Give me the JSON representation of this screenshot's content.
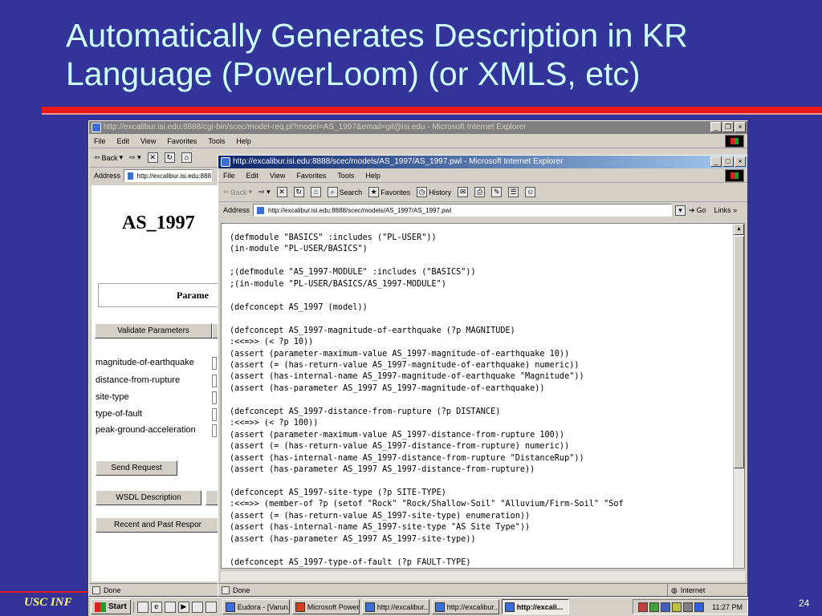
{
  "slide": {
    "title": "Automatically Generates Description in KR Language (PowerLoom) (or XMLS, etc)",
    "footer": "USC INF",
    "page_number": "24"
  },
  "back_window": {
    "title": "http://excalibur.isi.edu:8888/cgi-bin/scec/model-req.pl?model=AS_1997&email=gil@isi.edu - Microsoft Internet Explorer",
    "menu": [
      "File",
      "Edit",
      "View",
      "Favorites",
      "Tools",
      "Help"
    ],
    "toolbar": {
      "back": "Back"
    },
    "address_label": "Address",
    "address": "http://excalibur.isi.edu:888",
    "page_title": "AS_1997",
    "params_header": "Parame",
    "validate_button": "Validate Parameters",
    "params": [
      "magnitude-of-earthquake",
      "distance-from-rupture",
      "site-type",
      "type-of-fault",
      "peak-ground-acceleration"
    ],
    "send_button": "Send Request",
    "wsdl_button": "WSDL Description",
    "recent_button": "Recent and Past Respor",
    "status": "Done"
  },
  "front_window": {
    "title": "http://excalibur.isi.edu:8888/scec/models/AS_1997/AS_1997.pwl - Microsoft Internet Explorer",
    "menu": [
      "File",
      "Edit",
      "View",
      "Favorites",
      "Tools",
      "Help"
    ],
    "toolbar": {
      "back": "Back",
      "search": "Search",
      "favorites": "Favorites",
      "history": "History"
    },
    "address_label": "Address",
    "address": "http://excalibur.isi.edu:8888/scec/models/AS_1997/AS_1997.pwl",
    "go": "Go",
    "links": "Links",
    "code": "(defmodule \"BASICS\" :includes (\"PL-USER\"))\n(in-module \"PL-USER/BASICS\")\n\n;(defmodule \"AS_1997-MODULE\" :includes (\"BASICS\"))\n;(in-module \"PL-USER/BASICS/AS_1997-MODULE\")\n\n(defconcept AS_1997 (model))\n\n(defconcept AS_1997-magnitude-of-earthquake (?p MAGNITUDE)\n:<<=>> (< ?p 10))\n(assert (parameter-maximum-value AS_1997-magnitude-of-earthquake 10))\n(assert (= (has-return-value AS_1997-magnitude-of-earthquake) numeric))\n(assert (has-internal-name AS_1997-magnitude-of-earthquake \"Magnitude\"))\n(assert (has-parameter AS_1997 AS_1997-magnitude-of-earthquake))\n\n(defconcept AS_1997-distance-from-rupture (?p DISTANCE)\n:<<=>> (< ?p 100))\n(assert (parameter-maximum-value AS_1997-distance-from-rupture 100))\n(assert (= (has-return-value AS_1997-distance-from-rupture) numeric))\n(assert (has-internal-name AS_1997-distance-from-rupture \"DistanceRup\"))\n(assert (has-parameter AS_1997 AS_1997-distance-from-rupture))\n\n(defconcept AS_1997-site-type (?p SITE-TYPE)\n:<<=>> (member-of ?p (setof \"Rock\" \"Rock/Shallow-Soil\" \"Alluvium/Firm-Soil\" \"Sof\n(assert (= (has-return-value AS_1997-site-type) enumeration))\n(assert (has-internal-name AS_1997-site-type \"AS Site Type\"))\n(assert (has-parameter AS_1997 AS_1997-site-type))\n\n(defconcept AS_1997-type-of-fault (?p FAULT-TYPE)\n:<<=>> (member-of ?p (setof \"Reverse\" \"Reverse/Oblique\" \"Strike-Slip\" \"Thrust\" \"",
    "status": "Done",
    "zone": "Internet"
  },
  "taskbar": {
    "start": "Start",
    "tasks": [
      "Eudora - [Varun...",
      "Microsoft Power...",
      "http://excalibur...",
      "http://excalibur...",
      "http://excali..."
    ],
    "clock": "11:27 PM"
  }
}
